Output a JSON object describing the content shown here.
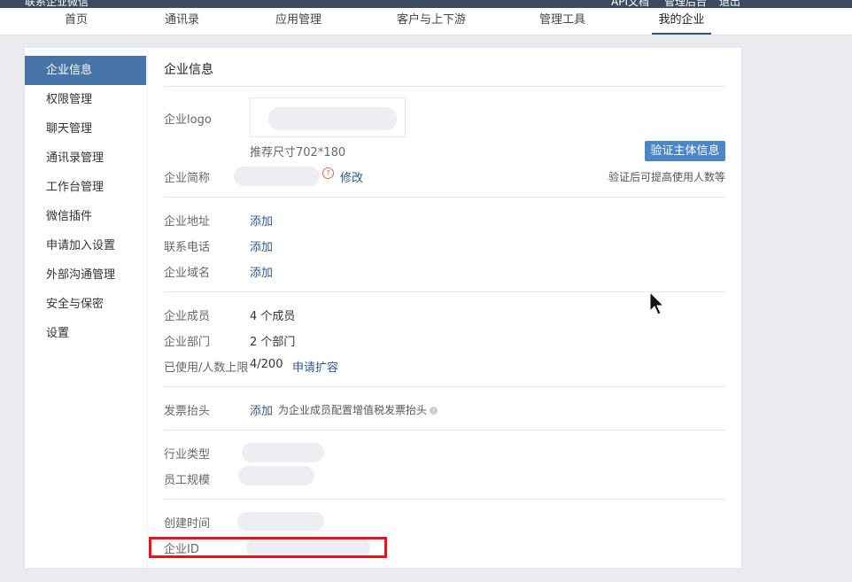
{
  "topbar": {
    "frag_left": "联系企业微信",
    "frag_right_1": "API文档",
    "frag_right_2": "管理后台",
    "frag_right_3": "退出"
  },
  "nav": {
    "items": [
      "首页",
      "通讯录",
      "应用管理",
      "客户与上下游",
      "管理工具",
      "我的企业"
    ],
    "active": "我的企业"
  },
  "sidebar": {
    "items": [
      "企业信息",
      "权限管理",
      "聊天管理",
      "通讯录管理",
      "工作台管理",
      "微信插件",
      "申请加入设置",
      "外部沟通管理",
      "安全与保密",
      "设置"
    ]
  },
  "main": {
    "title": "企业信息",
    "logo": {
      "label": "企业logo",
      "size_hint": "推荐尺寸702*180"
    },
    "verify": {
      "button": "验证主体信息",
      "hint": "验证后可提高使用人数等"
    },
    "short_name": {
      "label": "企业简称",
      "edit": "修改"
    },
    "address": {
      "label": "企业地址",
      "action": "添加"
    },
    "phone": {
      "label": "联系电话",
      "action": "添加"
    },
    "domain": {
      "label": "企业域名",
      "action": "添加"
    },
    "members": {
      "label": "企业成员",
      "value": "4 个成员"
    },
    "departments": {
      "label": "企业部门",
      "value": "2 个部门"
    },
    "usage": {
      "label": "已使用/人数上限",
      "value": "4/200",
      "action": "申请扩容"
    },
    "invoice": {
      "label": "发票抬头",
      "action": "添加",
      "hint": "为企业成员配置增值税发票抬头"
    },
    "industry": {
      "label": "行业类型"
    },
    "scale": {
      "label": "员工规模"
    },
    "created": {
      "label": "创建时间"
    },
    "corp_id": {
      "label": "企业ID"
    }
  },
  "colors": {
    "accent": "#4774a8",
    "link": "#2b5a8f",
    "highlight": "#e8141d",
    "topbar": "#3a4b63"
  }
}
